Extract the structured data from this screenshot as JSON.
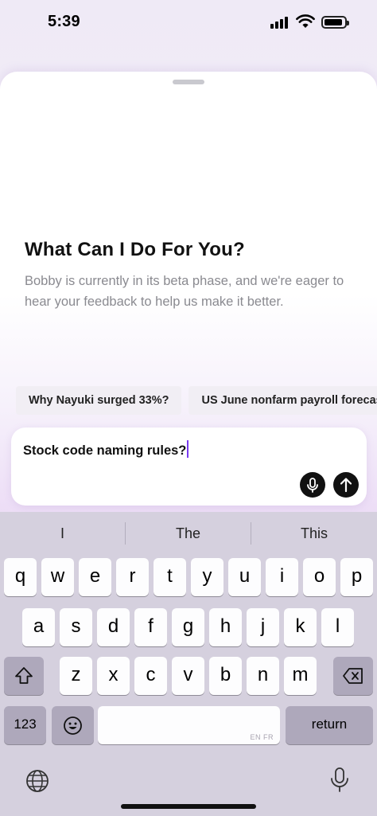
{
  "status": {
    "time": "5:39"
  },
  "sheet": {
    "title": "What Can I Do For You?",
    "subtitle": "Bobby is currently in its beta phase, and we're eager to hear your feedback to help us make it better."
  },
  "chips": [
    {
      "label": "Why Nayuki surged 33%?"
    },
    {
      "label": "US June nonfarm payroll forecast"
    }
  ],
  "composer": {
    "text": "Stock code naming rules?"
  },
  "keyboard": {
    "suggestions": [
      "I",
      "The",
      "This"
    ],
    "row1": [
      "q",
      "w",
      "e",
      "r",
      "t",
      "y",
      "u",
      "i",
      "o",
      "p"
    ],
    "row2": [
      "a",
      "s",
      "d",
      "f",
      "g",
      "h",
      "j",
      "k",
      "l"
    ],
    "row3": [
      "z",
      "x",
      "c",
      "v",
      "b",
      "n",
      "m"
    ],
    "numbers_label": "123",
    "space_hint": "EN FR",
    "return_label": "return"
  },
  "icons": {
    "shift": "shift-icon",
    "delete": "delete-icon",
    "emoji": "emoji-icon",
    "globe": "globe-icon",
    "dictation": "mic-icon",
    "send": "arrow-up-icon"
  }
}
